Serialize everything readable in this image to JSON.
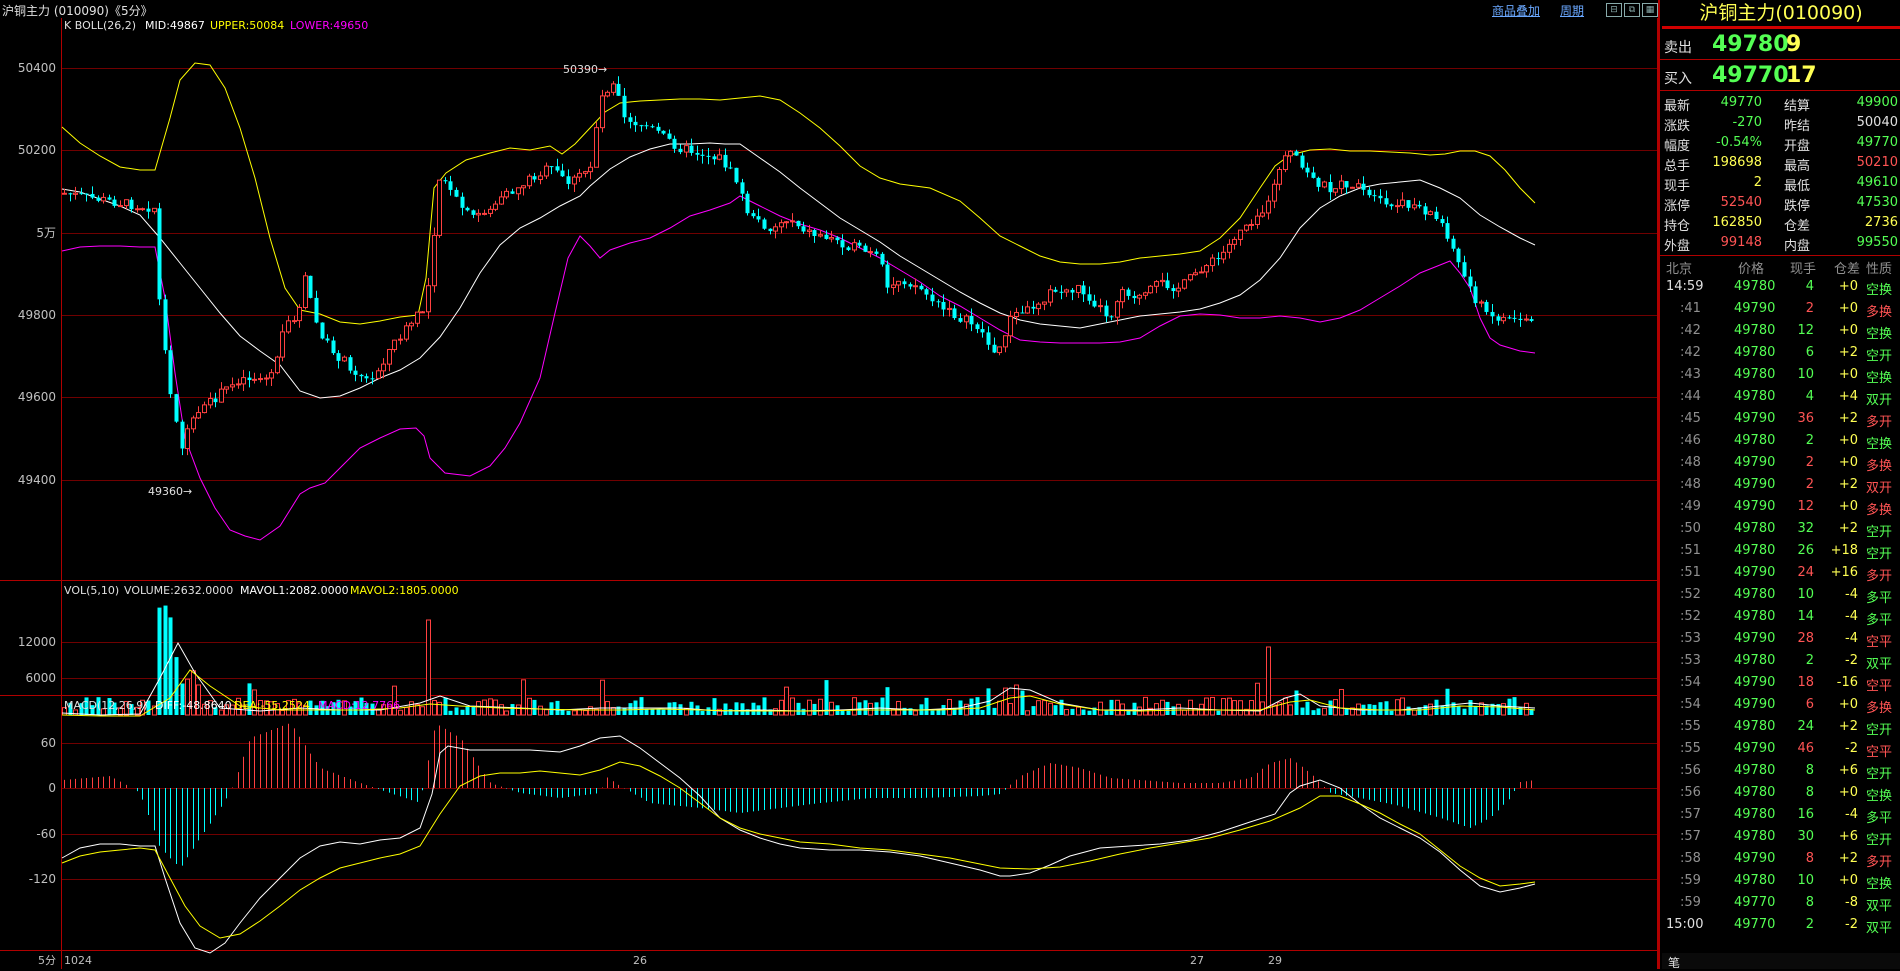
{
  "window": {
    "title": "沪铜主力 (010090)《5分》",
    "link_overlay": "商品叠加",
    "link_period": "周期"
  },
  "main_chart": {
    "indicator_label": "K  BOLL(26,2)",
    "mid_label": "MID:49867",
    "upper_label": "UPPER:50084",
    "lower_label": "LOWER:49650",
    "y_ticks": [
      "50400",
      "50200",
      "5万",
      "49800",
      "49600",
      "49400"
    ],
    "high_marker": "50390",
    "low_marker": "49360",
    "colors": {
      "up": "#ff4040",
      "down": "#00ffff",
      "mid": "#ffffff",
      "upper": "#ffff00",
      "lower": "#ff00ff",
      "grid": "#800000"
    }
  },
  "volume_chart": {
    "indicator_label": "VOL(5,10)",
    "volume_label": "VOLUME:2632.0000",
    "mavol1_label": "MAVOL1:2082.0000",
    "mavol2_label": "MAVOL2:1805.0000",
    "y_ticks": [
      "12000",
      "6000"
    ]
  },
  "macd_chart": {
    "indicator_label": "MACD(12,26,9)",
    "diff_label": "DIFF:-48.8640",
    "dea_label": "DEA:-55.2524",
    "macd_label": "MACD:12.7766",
    "y_ticks": [
      "60",
      "0",
      "-60",
      "-120"
    ]
  },
  "x_axis": {
    "period_label": "5分",
    "labels": [
      "1024",
      "26",
      "27",
      "29"
    ]
  },
  "quote_panel": {
    "title": "沪铜主力(010090)",
    "sell": {
      "label": "卖出",
      "price": "49780",
      "volume": "9"
    },
    "buy": {
      "label": "买入",
      "price": "49770",
      "volume": "17"
    },
    "stats": [
      {
        "l1": "最新",
        "v1": "49770",
        "c1": "g",
        "l2": "结算",
        "v2": "49900",
        "c2": "g"
      },
      {
        "l1": "涨跌",
        "v1": "-270",
        "c1": "g",
        "l2": "昨结",
        "v2": "50040",
        "c2": "w"
      },
      {
        "l1": "幅度",
        "v1": "-0.54%",
        "c1": "g",
        "l2": "开盘",
        "v2": "49770",
        "c2": "g"
      },
      {
        "l1": "总手",
        "v1": "198698",
        "c1": "y",
        "l2": "最高",
        "v2": "50210",
        "c2": "r"
      },
      {
        "l1": "现手",
        "v1": "2",
        "c1": "y",
        "l2": "最低",
        "v2": "49610",
        "c2": "g"
      },
      {
        "l1": "涨停",
        "v1": "52540",
        "c1": "r",
        "l2": "跌停",
        "v2": "47530",
        "c2": "g"
      },
      {
        "l1": "持仓",
        "v1": "162850",
        "c1": "y",
        "l2": "仓差",
        "v2": "2736",
        "c2": "y"
      },
      {
        "l1": "外盘",
        "v1": "99148",
        "c1": "r",
        "l2": "内盘",
        "v2": "99550",
        "c2": "g"
      }
    ],
    "ticks_header": {
      "time": "北京",
      "price": "价格",
      "vol": "现手",
      "oi": "仓差",
      "nature": "性质"
    },
    "ticks": [
      {
        "t": "14:59",
        "p": "49780",
        "pc": "g",
        "v": "4",
        "vc": "g",
        "o": "+0",
        "n": "空换",
        "nc": "g"
      },
      {
        "t": ":41",
        "p": "49790",
        "pc": "g",
        "v": "2",
        "vc": "r",
        "o": "+0",
        "n": "多换",
        "nc": "r"
      },
      {
        "t": ":42",
        "p": "49780",
        "pc": "g",
        "v": "12",
        "vc": "g",
        "o": "+0",
        "n": "空换",
        "nc": "g"
      },
      {
        "t": ":42",
        "p": "49780",
        "pc": "g",
        "v": "6",
        "vc": "g",
        "o": "+2",
        "n": "空开",
        "nc": "g"
      },
      {
        "t": ":43",
        "p": "49780",
        "pc": "g",
        "v": "10",
        "vc": "g",
        "o": "+0",
        "n": "空换",
        "nc": "g"
      },
      {
        "t": ":44",
        "p": "49780",
        "pc": "g",
        "v": "4",
        "vc": "g",
        "o": "+4",
        "n": "双开",
        "nc": "g"
      },
      {
        "t": ":45",
        "p": "49790",
        "pc": "g",
        "v": "36",
        "vc": "r",
        "o": "+2",
        "n": "多开",
        "nc": "r"
      },
      {
        "t": ":46",
        "p": "49780",
        "pc": "g",
        "v": "2",
        "vc": "g",
        "o": "+0",
        "n": "空换",
        "nc": "g"
      },
      {
        "t": ":48",
        "p": "49790",
        "pc": "g",
        "v": "2",
        "vc": "r",
        "o": "+0",
        "n": "多换",
        "nc": "r"
      },
      {
        "t": ":48",
        "p": "49790",
        "pc": "g",
        "v": "2",
        "vc": "r",
        "o": "+2",
        "n": "双开",
        "nc": "r"
      },
      {
        "t": ":49",
        "p": "49790",
        "pc": "g",
        "v": "12",
        "vc": "r",
        "o": "+0",
        "n": "多换",
        "nc": "r"
      },
      {
        "t": ":50",
        "p": "49780",
        "pc": "g",
        "v": "32",
        "vc": "g",
        "o": "+2",
        "n": "空开",
        "nc": "g"
      },
      {
        "t": ":51",
        "p": "49780",
        "pc": "g",
        "v": "26",
        "vc": "g",
        "o": "+18",
        "n": "空开",
        "nc": "g"
      },
      {
        "t": ":51",
        "p": "49790",
        "pc": "g",
        "v": "24",
        "vc": "r",
        "o": "+16",
        "n": "多开",
        "nc": "r"
      },
      {
        "t": ":52",
        "p": "49780",
        "pc": "g",
        "v": "10",
        "vc": "g",
        "o": "-4",
        "n": "多平",
        "nc": "g"
      },
      {
        "t": ":52",
        "p": "49780",
        "pc": "g",
        "v": "14",
        "vc": "g",
        "o": "-4",
        "n": "多平",
        "nc": "g"
      },
      {
        "t": ":53",
        "p": "49790",
        "pc": "g",
        "v": "28",
        "vc": "r",
        "o": "-4",
        "n": "空平",
        "nc": "r"
      },
      {
        "t": ":53",
        "p": "49780",
        "pc": "g",
        "v": "2",
        "vc": "g",
        "o": "-2",
        "n": "双平",
        "nc": "g"
      },
      {
        "t": ":54",
        "p": "49790",
        "pc": "g",
        "v": "18",
        "vc": "r",
        "o": "-16",
        "n": "空平",
        "nc": "r"
      },
      {
        "t": ":54",
        "p": "49790",
        "pc": "g",
        "v": "6",
        "vc": "r",
        "o": "+0",
        "n": "多换",
        "nc": "r"
      },
      {
        "t": ":55",
        "p": "49780",
        "pc": "g",
        "v": "24",
        "vc": "g",
        "o": "+2",
        "n": "空开",
        "nc": "g"
      },
      {
        "t": ":55",
        "p": "49790",
        "pc": "g",
        "v": "46",
        "vc": "r",
        "o": "-2",
        "n": "空平",
        "nc": "r"
      },
      {
        "t": ":56",
        "p": "49780",
        "pc": "g",
        "v": "8",
        "vc": "g",
        "o": "+6",
        "n": "空开",
        "nc": "g"
      },
      {
        "t": ":56",
        "p": "49780",
        "pc": "g",
        "v": "8",
        "vc": "g",
        "o": "+0",
        "n": "空换",
        "nc": "g"
      },
      {
        "t": ":57",
        "p": "49780",
        "pc": "g",
        "v": "16",
        "vc": "g",
        "o": "-4",
        "n": "多平",
        "nc": "g"
      },
      {
        "t": ":57",
        "p": "49780",
        "pc": "g",
        "v": "30",
        "vc": "g",
        "o": "+6",
        "n": "空开",
        "nc": "g"
      },
      {
        "t": ":58",
        "p": "49790",
        "pc": "g",
        "v": "8",
        "vc": "r",
        "o": "+2",
        "n": "多开",
        "nc": "r"
      },
      {
        "t": ":59",
        "p": "49780",
        "pc": "g",
        "v": "10",
        "vc": "g",
        "o": "+0",
        "n": "空换",
        "nc": "g"
      },
      {
        "t": ":59",
        "p": "49770",
        "pc": "g",
        "v": "8",
        "vc": "g",
        "o": "-8",
        "n": "双平",
        "nc": "g"
      },
      {
        "t": "15:00",
        "p": "49770",
        "pc": "g",
        "v": "2",
        "vc": "g",
        "o": "-2",
        "n": "双平",
        "nc": "g"
      }
    ],
    "bottom_tab": "笔"
  }
}
